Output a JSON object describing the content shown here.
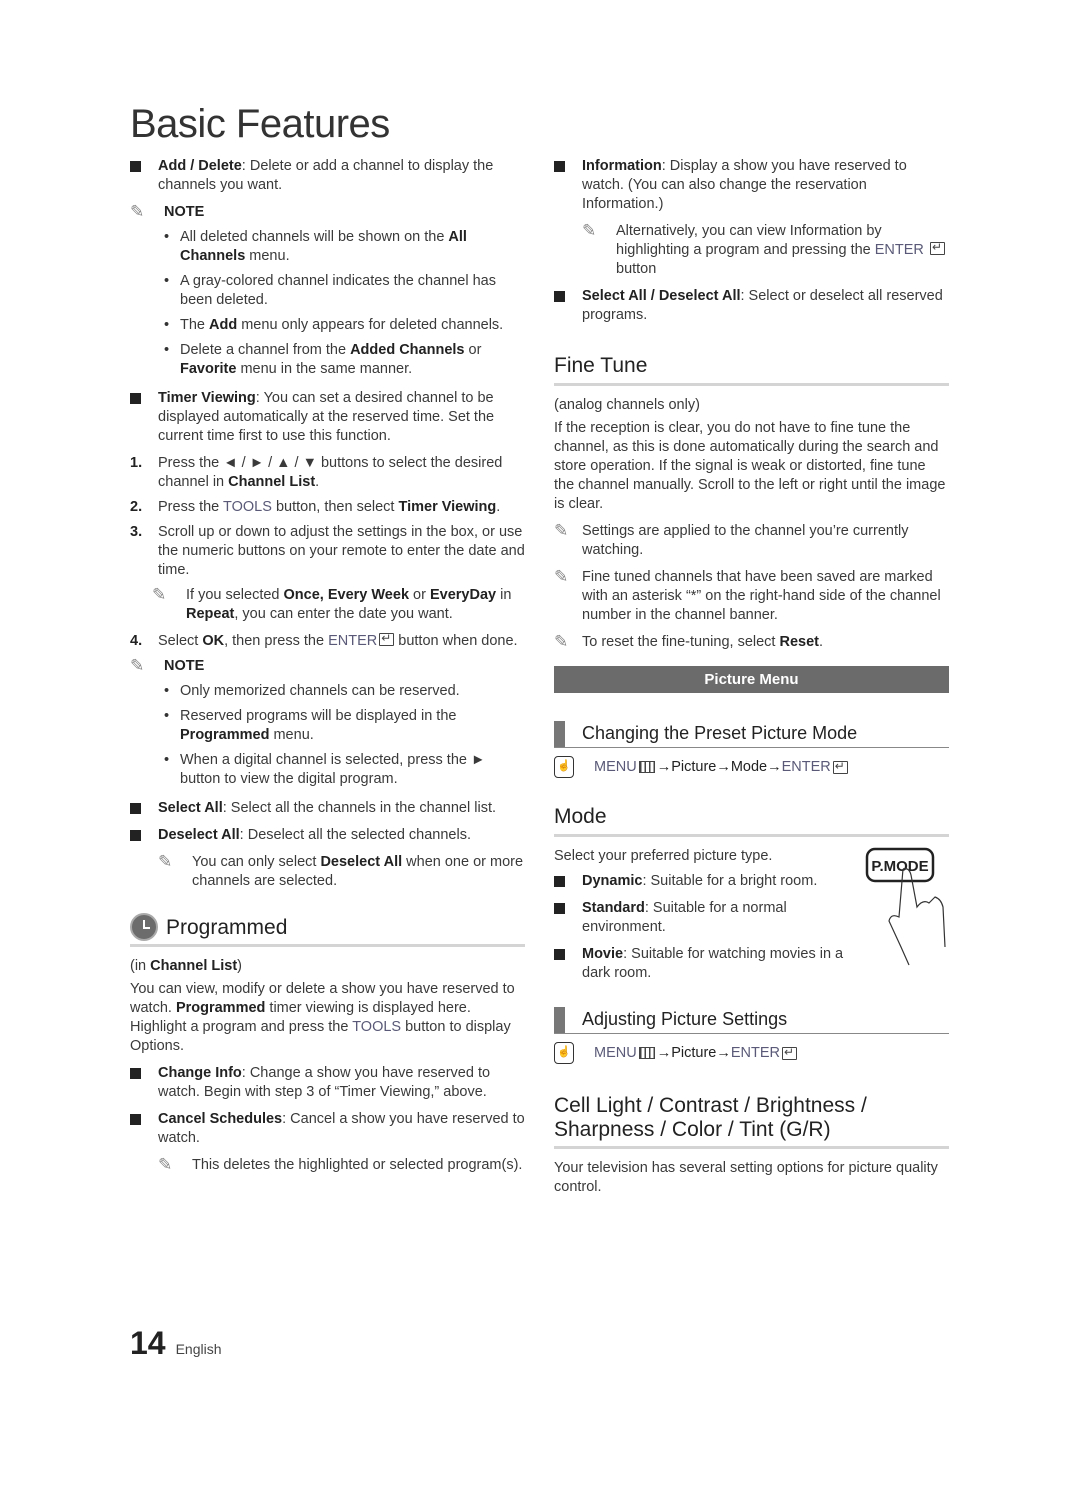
{
  "page_title": "Basic Features",
  "left": {
    "add_delete": {
      "term": "Add / Delete",
      "text": ": Delete or add a channel to display the channels you want."
    },
    "note1_label": "NOTE",
    "note1_items": [
      {
        "pre": "All deleted channels will be shown on the ",
        "b": "All Channels",
        "post": " menu."
      },
      {
        "pre": "A gray-colored channel indicates the channel has been deleted.",
        "b": "",
        "post": ""
      },
      {
        "pre": "The ",
        "b": "Add",
        "post": " menu only appears for deleted channels."
      },
      {
        "pre": "Delete a channel from the ",
        "b": "Added Channels",
        "post": " or ",
        "b2": "Favorite",
        "post2": " menu in the same manner."
      }
    ],
    "timer": {
      "term": "Timer Viewing",
      "text": ": You can set a desired channel to be displayed automatically at the reserved time. Set the current time first to use this function."
    },
    "steps": [
      {
        "n": "1.",
        "pre": "Press the ◄ / ► / ▲ / ▼ buttons to select the desired channel in ",
        "b": "Channel List",
        "post": "."
      },
      {
        "n": "2.",
        "pre": "Press the ",
        "kw": "TOOLS",
        "mid": " button, then select ",
        "b": "Timer Viewing",
        "post": "."
      },
      {
        "n": "3.",
        "pre": "Scroll up or down to adjust the settings in the box, or use the numeric buttons on your remote to enter the date and time."
      },
      {
        "n": "4.",
        "pre": "Select ",
        "b": "OK",
        "mid": ", then press the ",
        "kw": "ENTER",
        "post": " button when done."
      }
    ],
    "step3_note": {
      "pre": "If you selected ",
      "b": "Once, Every Week",
      "mid": " or ",
      "b2": "EveryDay",
      "mid2": " in ",
      "b3": "Repeat",
      "post": ", you can enter the date you want."
    },
    "note2_label": "NOTE",
    "note2_items": [
      {
        "pre": "Only memorized channels can be reserved."
      },
      {
        "pre": "Reserved programs will be displayed in the ",
        "b": "Programmed",
        "post": " menu."
      },
      {
        "pre": "When a digital channel is selected, press the ► button to view the digital program."
      }
    ],
    "select_all": {
      "term": "Select All",
      "text": ": Select all the channels in the channel list."
    },
    "deselect_all": {
      "term": "Deselect All",
      "text": ": Deselect all the selected channels."
    },
    "deselect_note": {
      "pre": "You can only select ",
      "b": "Deselect All",
      "post": " when one or more channels are selected."
    },
    "programmed": {
      "title": "Programmed",
      "context_pre": "(in ",
      "context_b": "Channel List",
      "context_post": ")",
      "body_pre": "You can view, modify or delete a show you have reserved to watch. ",
      "body_b": "Programmed",
      "body_mid": " timer viewing is displayed here. Highlight a program and press the ",
      "body_kw": "TOOLS",
      "body_post": " button to display Options.",
      "change_info": {
        "term": "Change Info",
        "text": ": Change a show you have reserved to watch. Begin with step 3 of “Timer Viewing,” above."
      },
      "cancel": {
        "term": "Cancel Schedules",
        "text": ": Cancel a show you have reserved to watch."
      },
      "cancel_note": "This deletes the highlighted or selected program(s)."
    }
  },
  "right": {
    "information": {
      "term": "Information",
      "text": ": Display a show you have reserved to watch. (You can also change the reservation Information.)"
    },
    "info_note": {
      "pre": "Alternatively, you can view Information by highlighting a program and pressing the ",
      "kw": "ENTER",
      "post": " button"
    },
    "select_deselect": {
      "term": "Select All / Deselect All",
      "text": ": Select or deselect all reserved programs."
    },
    "fine_tune": {
      "title": "Fine Tune",
      "context": "(analog channels only)",
      "body": "If the reception is clear, you do not have to fine tune the channel, as this is done automatically during the search and store operation. If the signal is weak or distorted, fine tune the channel manually. Scroll to the left or right until the image is clear.",
      "notes": [
        "Settings are applied to the channel you’re currently watching.",
        "Fine tuned channels that have been saved are marked with an asterisk “*” on the right-hand side of the channel number in the channel banner."
      ],
      "reset_pre": "To reset the fine-tuning, select ",
      "reset_b": "Reset",
      "reset_post": "."
    },
    "picture_menu_bar": "Picture Menu",
    "preset": {
      "title": "Changing the Preset Picture Mode",
      "path_menu": "MENU",
      "path_arrow1": " → ",
      "path_picture": "Picture",
      "path_arrow2": " → ",
      "path_mode": "Mode",
      "path_arrow3": " → ",
      "path_enter": "ENTER"
    },
    "mode": {
      "title": "Mode",
      "intro": "Select your preferred picture type.",
      "items": [
        {
          "term": "Dynamic",
          "text": ": Suitable for a bright room."
        },
        {
          "term": "Standard",
          "text": ": Suitable for a normal environment."
        },
        {
          "term": "Movie",
          "text": ": Suitable for watching movies in a dark room."
        }
      ],
      "button_label": "P.MODE"
    },
    "adjusting": {
      "title": "Adjusting Picture Settings",
      "path_menu": "MENU",
      "path_arrow1": " → ",
      "path_picture": "Picture",
      "path_arrow2": " → ",
      "path_enter": "ENTER"
    },
    "cell_light": {
      "title": "Cell Light / Contrast / Brightness / Sharpness / Color / Tint (G/R)",
      "body": "Your television has several setting options for picture quality control."
    }
  },
  "footer": {
    "page_number": "14",
    "language": "English"
  },
  "colors": {
    "keyword": "#5a5a78",
    "bar": "#6b6b6b",
    "rule": "#d4d4d4"
  }
}
